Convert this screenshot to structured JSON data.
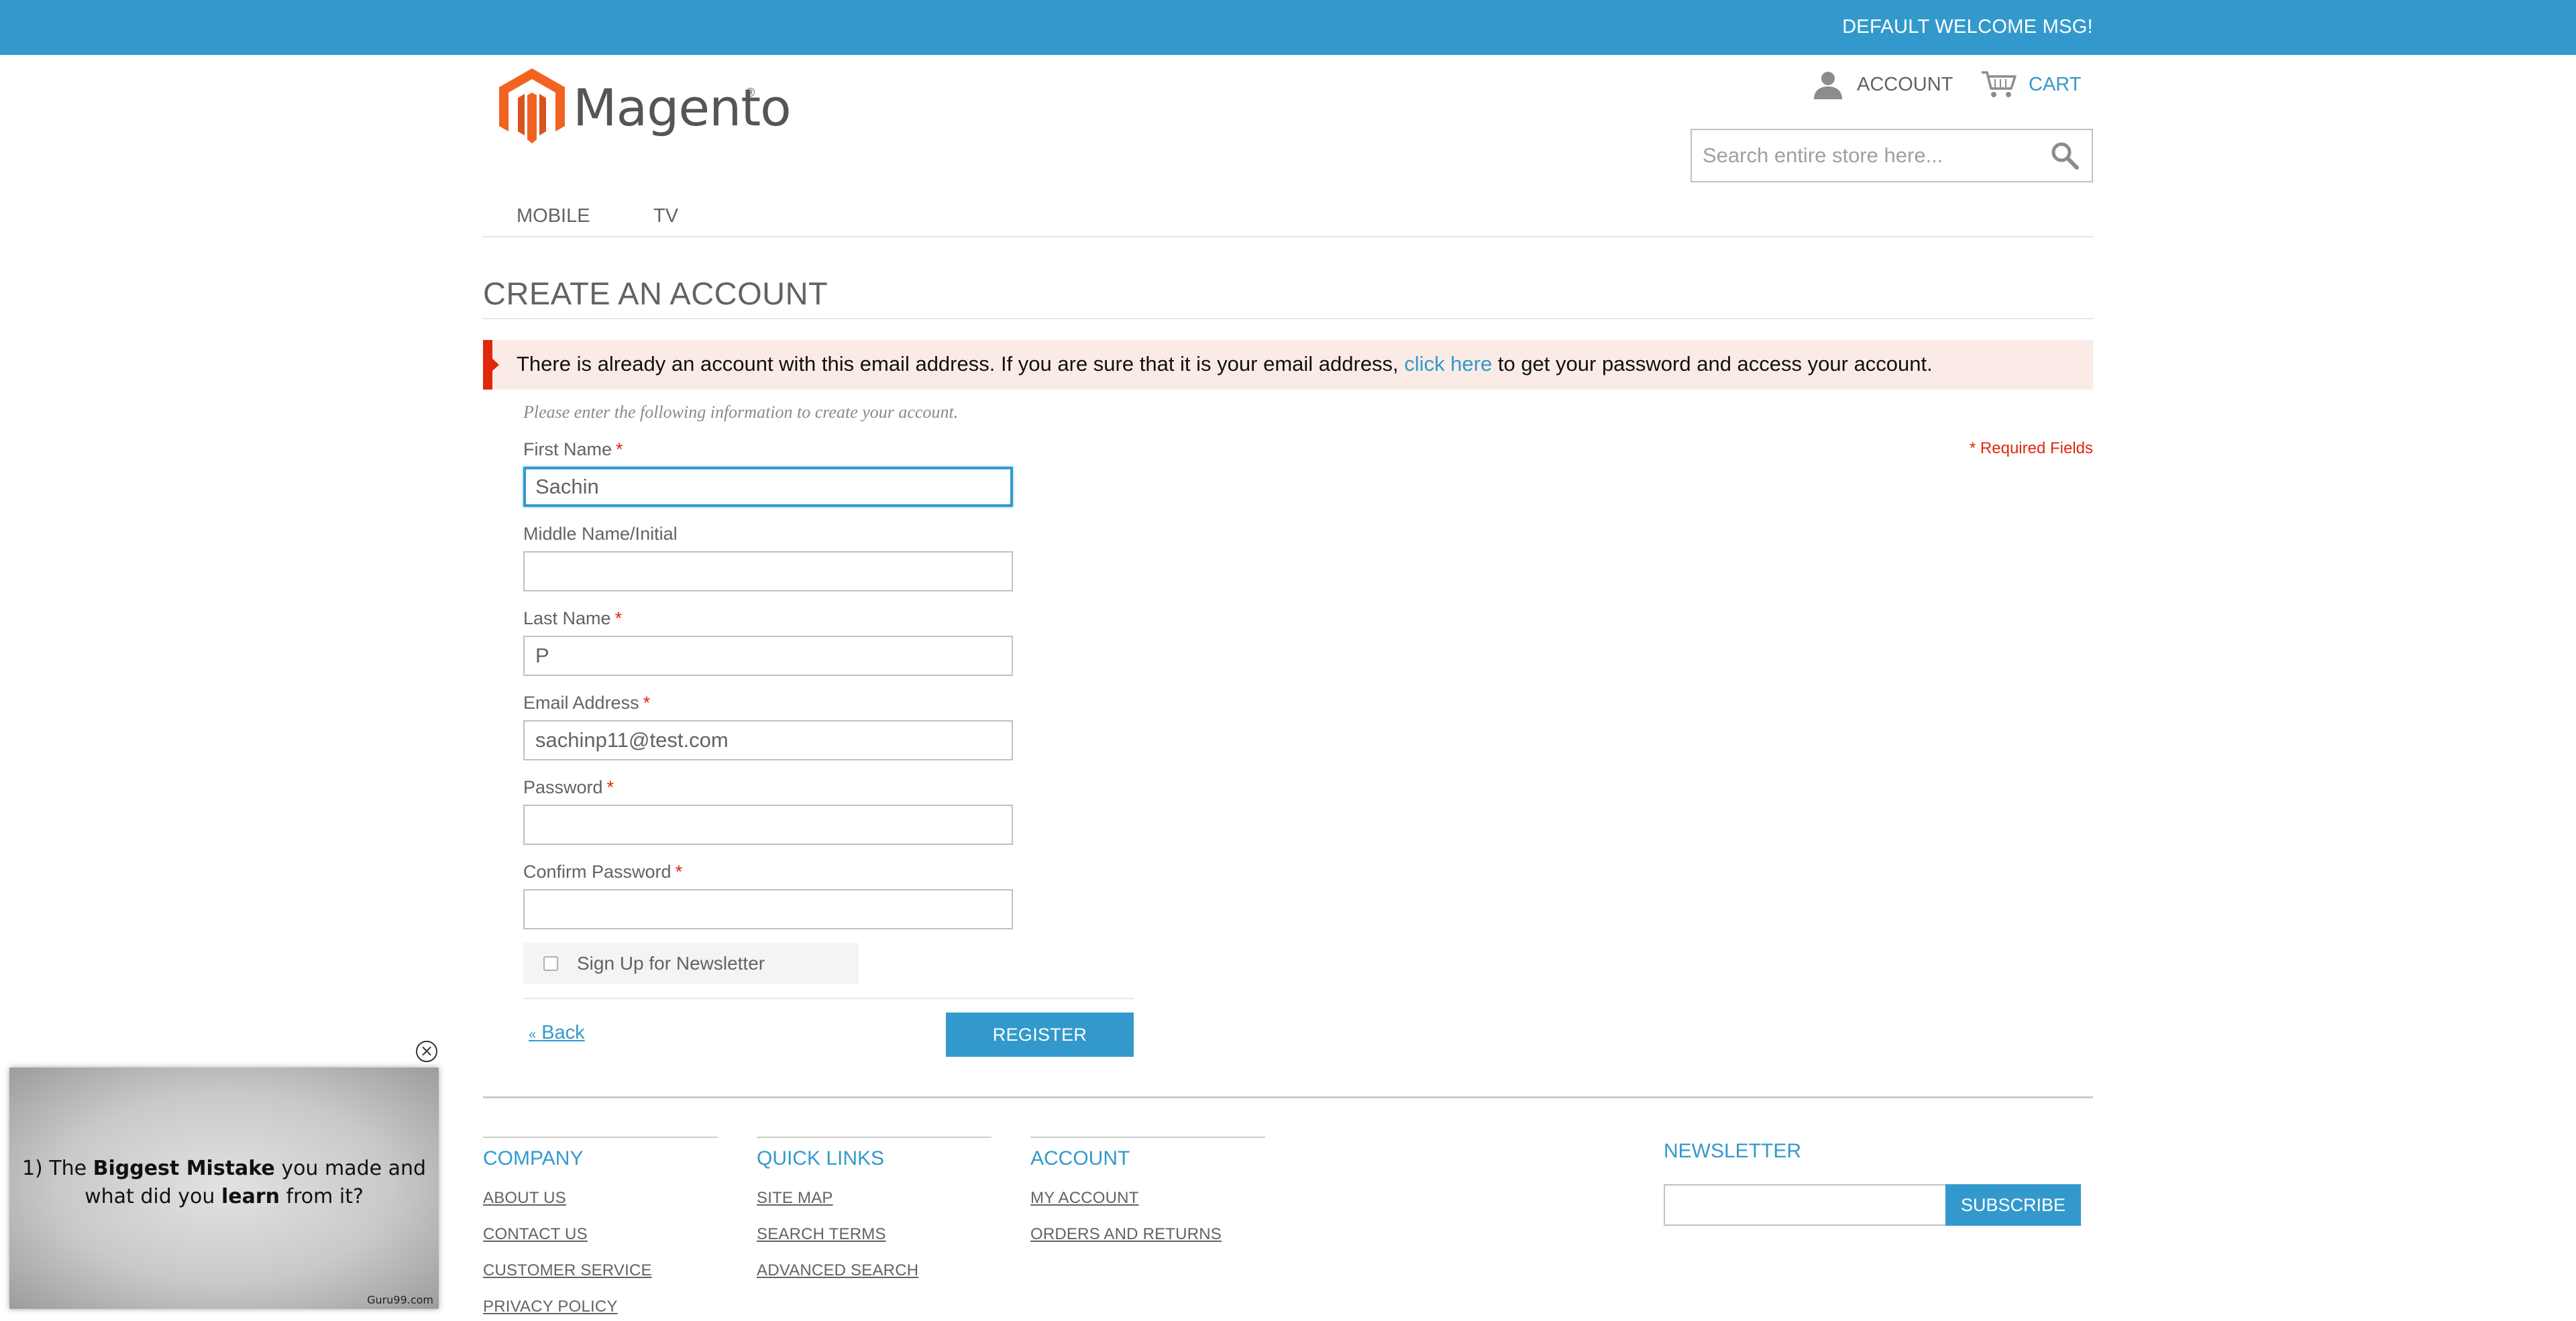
{
  "topbar": {
    "welcome": "DEFAULT WELCOME MSG!"
  },
  "header": {
    "logo_text": "Magento",
    "logo_reg": "®",
    "account_label": "ACCOUNT",
    "cart_label": "CART",
    "search_placeholder": "Search entire store here...",
    "icons": {
      "account": "user-icon",
      "cart": "cart-icon",
      "search": "search-icon",
      "logo": "magento-logo-icon"
    }
  },
  "nav": {
    "items": [
      "MOBILE",
      "TV"
    ]
  },
  "page": {
    "title": "CREATE AN ACCOUNT",
    "error": {
      "before": "There is already an account with this email address. If you are sure that it is your email address, ",
      "link": "click here",
      "after": " to get your password and access your account."
    },
    "intro": "Please enter the following information to create your account.",
    "required_note": "* Required Fields"
  },
  "form": {
    "required_mark": "*",
    "first_name": {
      "label": "First Name",
      "value": "Sachin"
    },
    "middle_name": {
      "label": "Middle Name/Initial",
      "value": ""
    },
    "last_name": {
      "label": "Last Name",
      "value": "P"
    },
    "email": {
      "label": "Email Address",
      "value": "sachinp11@test.com"
    },
    "password": {
      "label": "Password",
      "value": ""
    },
    "confirm_password": {
      "label": "Confirm Password",
      "value": ""
    },
    "newsletter_label": "Sign Up for Newsletter",
    "newsletter_checked": false,
    "back_arrow": "«",
    "back_label": "Back",
    "register_label": "REGISTER"
  },
  "footer": {
    "company": {
      "heading": "COMPANY",
      "links": [
        "ABOUT US",
        "CONTACT US",
        "CUSTOMER SERVICE",
        "PRIVACY POLICY"
      ]
    },
    "quick_links": {
      "heading": "QUICK LINKS",
      "links": [
        "SITE MAP",
        "SEARCH TERMS",
        "ADVANCED SEARCH"
      ]
    },
    "account": {
      "heading": "ACCOUNT",
      "links": [
        "MY ACCOUNT",
        "ORDERS AND RETURNS"
      ]
    },
    "newsletter": {
      "heading": "NEWSLETTER",
      "subscribe_label": "SUBSCRIBE"
    }
  },
  "popup": {
    "q_prefix": "1) The ",
    "q_bold1": "Biggest Mistake",
    "q_mid1": " you made and",
    "q_line2_prefix": "what did you ",
    "q_bold2": "learn",
    "q_suffix": " from it?",
    "brand": "Guru99.com",
    "close_glyph": "×"
  },
  "colors": {
    "accent": "#3399cc",
    "error_red": "#df280a",
    "error_bg": "#faebe7",
    "logo_orange": "#f26322",
    "text": "#636363"
  }
}
